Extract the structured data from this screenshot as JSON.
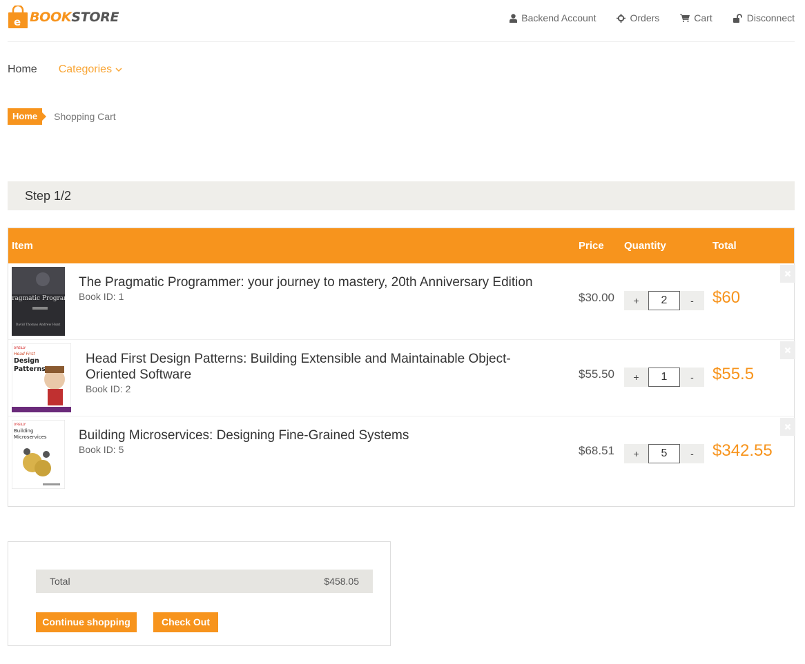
{
  "header": {
    "logo_letter": "e",
    "logo_part1": "BOOK",
    "logo_part2": "STORE",
    "links": [
      {
        "label": "Backend Account",
        "icon": "user-icon"
      },
      {
        "label": "Orders",
        "icon": "crosshair-icon"
      },
      {
        "label": "Cart",
        "icon": "cart-icon"
      },
      {
        "label": "Disconnect",
        "icon": "unlock-icon"
      }
    ]
  },
  "nav": {
    "home": "Home",
    "categories": "Categories"
  },
  "breadcrumb": {
    "home": "Home",
    "current": "Shopping Cart"
  },
  "step": "Step 1/2",
  "cart": {
    "headers": {
      "item": "Item",
      "price": "Price",
      "quantity": "Quantity",
      "total": "Total"
    },
    "items": [
      {
        "title": "The Pragmatic Programmer: your journey to mastery, 20th Anniversary Edition",
        "book_id": "Book ID: 1",
        "price": "$30.00",
        "quantity": "2",
        "total": "$60",
        "cover_title": "The Pragmatic Programmer",
        "cover_authors": "David Thomas  Andrew Hunt"
      },
      {
        "title": "Head First Design Patterns: Building Extensible and Maintainable Object-Oriented Software",
        "book_id": "Book ID: 2",
        "price": "$55.50",
        "quantity": "1",
        "total": "$55.5",
        "cover_publisher": "O'REILLY",
        "cover_series": "Head First",
        "cover_title": "Design Patterns"
      },
      {
        "title": "Building Microservices: Designing Fine-Grained Systems",
        "book_id": "Book ID: 5",
        "price": "$68.51",
        "quantity": "5",
        "total": "$342.55",
        "cover_publisher": "O'REILLY",
        "cover_title": "Building Microservices"
      }
    ],
    "plus": "+",
    "minus": "-"
  },
  "summary": {
    "total_label": "Total",
    "total_value": "$458.05",
    "continue_label": "Continue shopping",
    "checkout_label": "Check Out"
  }
}
